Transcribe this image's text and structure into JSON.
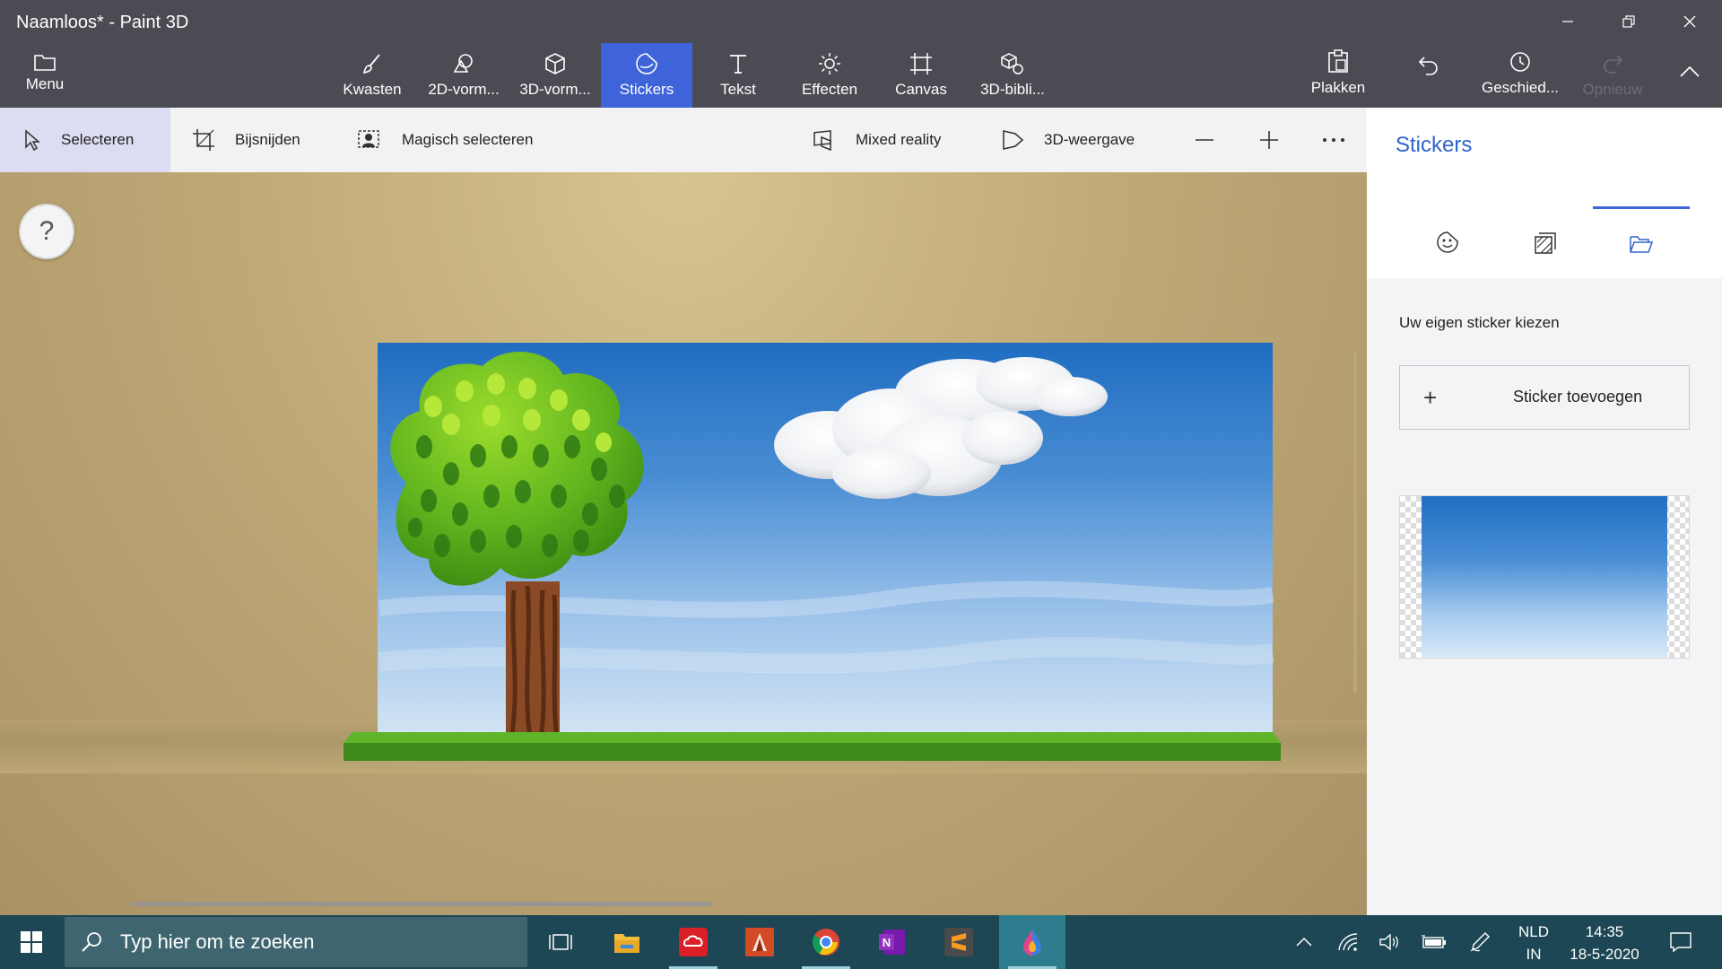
{
  "window": {
    "title": "Naamloos* - Paint 3D",
    "controls": [
      "minimize",
      "restore",
      "close"
    ]
  },
  "ribbon": {
    "menu_label": "Menu",
    "tools": [
      {
        "label": "Kwasten",
        "icon": "brush-icon"
      },
      {
        "label": "2D-vorm...",
        "icon": "2d-shapes-icon"
      },
      {
        "label": "3D-vorm...",
        "icon": "3d-shapes-icon"
      },
      {
        "label": "Stickers",
        "icon": "stickers-icon",
        "active": true
      },
      {
        "label": "Tekst",
        "icon": "text-icon"
      },
      {
        "label": "Effecten",
        "icon": "effects-icon"
      },
      {
        "label": "Canvas",
        "icon": "canvas-icon"
      },
      {
        "label": "3D-bibli...",
        "icon": "3d-library-icon"
      }
    ],
    "paste_label": "Plakken",
    "history_label": "Geschied...",
    "redo_label": "Opnieuw",
    "accent_color": "#3f63d8"
  },
  "subtoolbar": {
    "select_label": "Selecteren",
    "crop_label": "Bijsnijden",
    "magic_select_label": "Magisch selecteren",
    "mixed_reality_label": "Mixed reality",
    "view3d_label": "3D-weergave"
  },
  "canvas": {
    "help_label": "?"
  },
  "panel": {
    "title": "Stickers",
    "tabs": [
      "stickers-icon",
      "textures-icon",
      "custom-sticker-icon"
    ],
    "active_tab": 2,
    "subtitle": "Uw eigen sticker kiezen",
    "add_button_label": "Sticker toevoegen"
  },
  "taskbar": {
    "search_placeholder": "Typ hier om te zoeken",
    "apps": [
      "task-view-icon",
      "file-explorer-icon",
      "creative-cloud-icon",
      "office-lens-icon",
      "chrome-icon",
      "onenote-icon",
      "sublime-text-icon",
      "paint-3d-icon"
    ],
    "lang_top": "NLD",
    "lang_bottom": "IN",
    "time": "14:35",
    "date": "18-5-2020"
  }
}
